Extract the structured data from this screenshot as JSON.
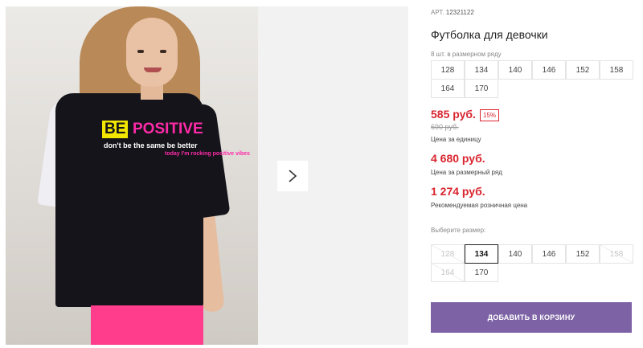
{
  "product": {
    "article_label": "АРТ.",
    "article_number": "12321122",
    "title": "Футболка для девочки",
    "print_be": "BE",
    "print_positive": "POSITIVE",
    "print_sub": "don't be the same be better",
    "print_sub2": "today I'm rocking positive vibes"
  },
  "size_row": {
    "note": "8 шт. в размерном ряду",
    "sizes": [
      "128",
      "134",
      "140",
      "146",
      "152",
      "158",
      "164",
      "170"
    ]
  },
  "prices": {
    "unit_price": "585 руб.",
    "discount_badge": "15%",
    "old_price": "690 руб.",
    "unit_label": "Цена за единицу",
    "row_price": "4 680 руб.",
    "row_label": "Цена за размерный ряд",
    "retail_price": "1 274 руб.",
    "retail_label": "Рекомендуемая розничная цена"
  },
  "size_picker": {
    "label": "Выберите размер:",
    "selected": "134",
    "options": [
      {
        "size": "128",
        "available": false
      },
      {
        "size": "134",
        "available": true
      },
      {
        "size": "140",
        "available": true
      },
      {
        "size": "146",
        "available": true
      },
      {
        "size": "152",
        "available": true
      },
      {
        "size": "158",
        "available": false
      },
      {
        "size": "164",
        "available": false
      },
      {
        "size": "170",
        "available": true
      }
    ]
  },
  "actions": {
    "add_to_cart": "ДОБАВИТЬ В КОРЗИНУ",
    "next_icon": "chevron-right-icon"
  },
  "colors": {
    "accent": "#7d63a5",
    "price_red": "#d9252f"
  }
}
